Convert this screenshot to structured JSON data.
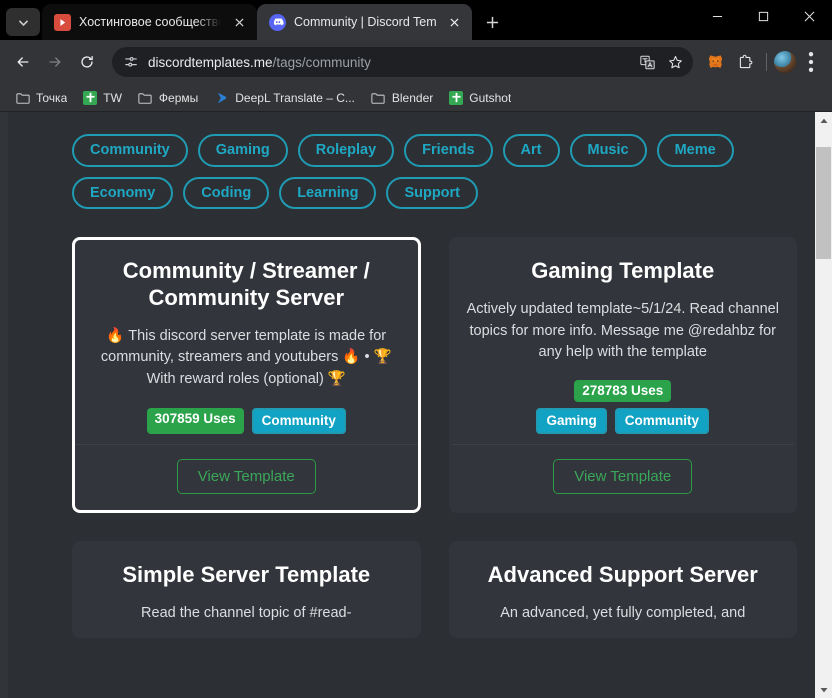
{
  "browser": {
    "tabs": [
      {
        "title": "Хостинговое сообщество «Tim",
        "favicon": "red-play-icon",
        "active": false
      },
      {
        "title": "Community | Discord Templates",
        "favicon": "discord-icon",
        "active": true
      }
    ],
    "new_tab_label": "+",
    "window_controls": {
      "minimize": "minimize-icon",
      "maximize": "maximize-icon",
      "close": "close-icon"
    },
    "toolbar": {
      "back": "back-icon",
      "forward": "forward-icon",
      "reload": "reload-icon",
      "url_host": "discordtemplates.me",
      "url_path": "/tags/community",
      "site_settings_icon": "tune-icon",
      "translate_icon": "translate-icon",
      "bookmark_icon": "star-icon",
      "metamask_icon": "fox-icon",
      "extensions_icon": "puzzle-icon",
      "profile_icon": "avatar-icon",
      "menu_icon": "kebab-icon"
    },
    "bookmarks": [
      {
        "label": "Точка",
        "icon": "folder-icon"
      },
      {
        "label": "TW",
        "icon": "green-app-icon"
      },
      {
        "label": "Фермы",
        "icon": "folder-icon"
      },
      {
        "label": "DeepL Translate – C...",
        "icon": "deepl-icon"
      },
      {
        "label": "Blender",
        "icon": "folder-icon"
      },
      {
        "label": "Gutshot",
        "icon": "green-app-icon"
      }
    ]
  },
  "page": {
    "tags": [
      "Community",
      "Gaming",
      "Roleplay",
      "Friends",
      "Art",
      "Music",
      "Meme",
      "Economy",
      "Coding",
      "Learning",
      "Support"
    ],
    "cards": [
      {
        "title": "Community / Streamer / Community Server",
        "description": "🔥 This discord server template is made for community, streamers and youtubers 🔥 • 🏆 With reward roles (optional) 🏆",
        "uses": "307859 Uses",
        "tags": [
          "Community"
        ],
        "button": "View Template",
        "selected": true
      },
      {
        "title": "Gaming Template",
        "description": "Actively updated template~5/1/24. Read channel topics for more info. Message me @redahbz for any help with the template",
        "uses": "278783 Uses",
        "tags": [
          "Gaming",
          "Community"
        ],
        "button": "View Template",
        "selected": false
      },
      {
        "title": "Simple Server Template",
        "description": "Read the channel topic of #read-",
        "uses": "",
        "tags": [],
        "button": "",
        "selected": false
      },
      {
        "title": "Advanced Support Server",
        "description": "An advanced, yet fully completed, and",
        "uses": "",
        "tags": [],
        "button": "",
        "selected": false
      }
    ],
    "colors": {
      "background": "#2c2f33",
      "card": "#32353b",
      "tag_accent": "#1fa8c4",
      "uses_badge": "#2aa34a",
      "tag_badge": "#12a2c4",
      "view_button": "#3aa75a",
      "selected_border": "#ffffff"
    }
  },
  "scrollbar": {
    "position": "near-top"
  }
}
